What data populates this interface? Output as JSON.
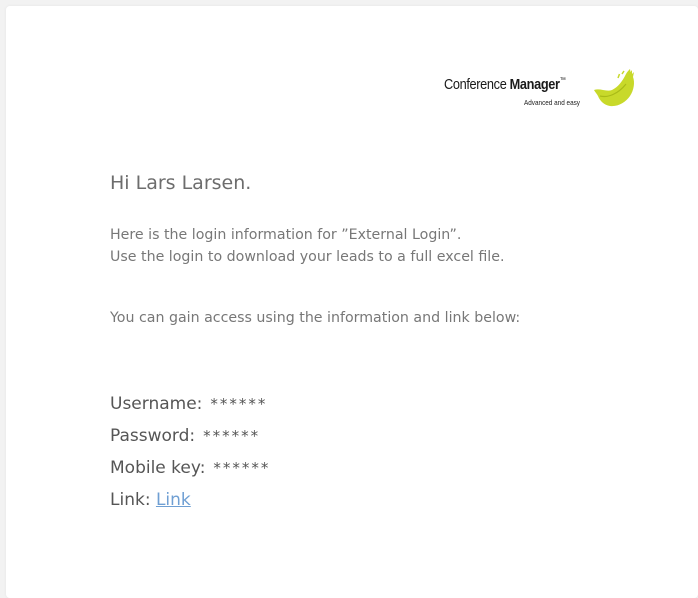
{
  "logo": {
    "name_light": "Conference ",
    "name_bold": "Manager",
    "trademark": "™",
    "tagline": "Advanced and easy",
    "accent_color": "#c8d92a"
  },
  "email": {
    "greeting": "Hi Lars Larsen.",
    "intro_line1": "Here is the login information for ”External Login”.",
    "intro_line2": "Use the login to download your leads to a full excel file.",
    "access_text": "You can gain access using the information and link below:"
  },
  "credentials": {
    "username_label": "Username:",
    "username_value": "******",
    "password_label": "Password:",
    "password_value": "******",
    "mobile_key_label": "Mobile key:",
    "mobile_key_value": "******",
    "link_label": "Link:",
    "link_text": "Link"
  }
}
